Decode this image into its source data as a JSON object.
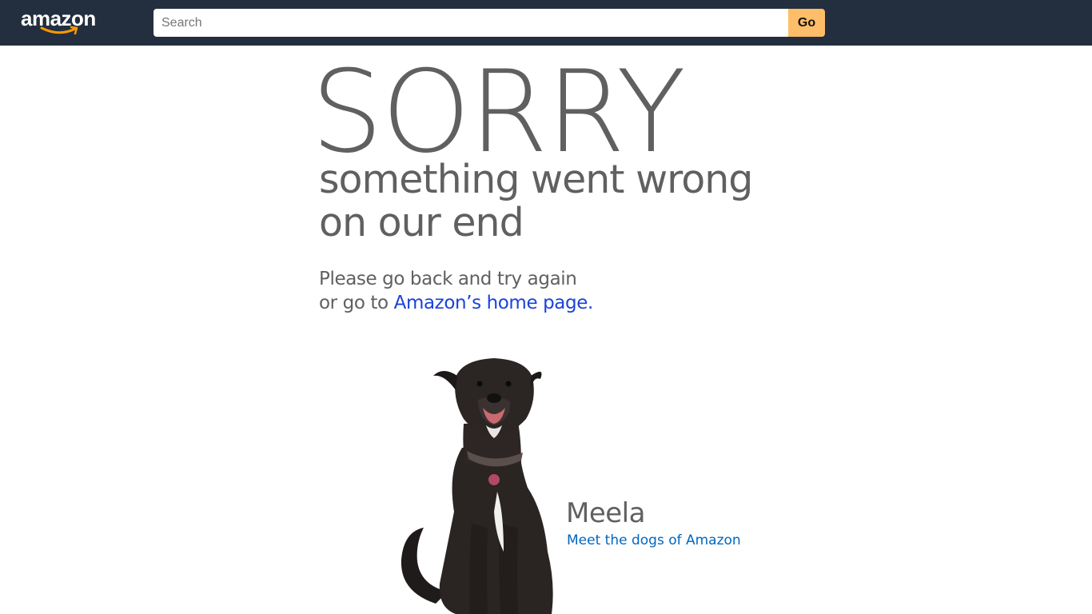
{
  "header": {
    "logo_text": "amazon",
    "search": {
      "placeholder": "Search",
      "value": ""
    },
    "go_label": "Go"
  },
  "main": {
    "sorry": "SORRY",
    "subtitle_line1": "something went wrong",
    "subtitle_line2": "on our end",
    "message_line1": "Please go back and try again",
    "message_line2_prefix": "or go to ",
    "home_link": "Amazon’s home page.",
    "dog_name": "Meela",
    "dogs_link": "Meet the dogs of Amazon"
  },
  "colors": {
    "topbar": "#232f3e",
    "go_button": "#febd69",
    "logo_smile": "#ff9900",
    "text_gray": "#606060",
    "home_link": "#1a43d8",
    "dogs_link": "#0066c0"
  }
}
